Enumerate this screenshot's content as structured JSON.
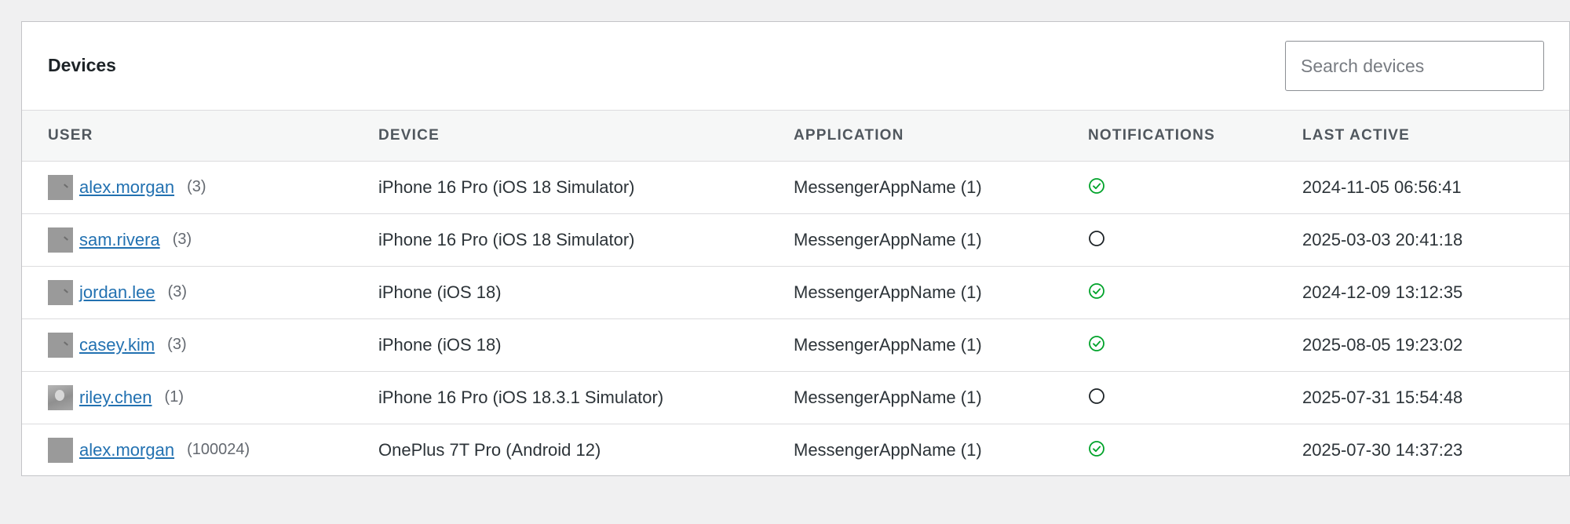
{
  "panel": {
    "title": "Devices",
    "search_placeholder": "Search devices"
  },
  "columns": {
    "user": "USER",
    "device": "DEVICE",
    "application": "APPLICATION",
    "notifications": "NOTIFICATIONS",
    "last_active": "LAST ACTIVE"
  },
  "rows": [
    {
      "user": "alex.morgan",
      "count": "(3)",
      "device": "iPhone 16 Pro (iOS 18 Simulator)",
      "application": "MessengerAppName (1)",
      "notifications": "enabled-check-icon",
      "last_active": "2024-11-05 06:56:41"
    },
    {
      "user": "sam.rivera",
      "count": "(3)",
      "device": "iPhone 16 Pro (iOS 18 Simulator)",
      "application": "MessengerAppName (1)",
      "notifications": "disabled-circle-icon",
      "last_active": "2025-03-03 20:41:18"
    },
    {
      "user": "jordan.lee",
      "count": "(3)",
      "device": "iPhone (iOS 18)",
      "application": "MessengerAppName (1)",
      "notifications": "enabled-check-icon",
      "last_active": "2024-12-09 13:12:35"
    },
    {
      "user": "casey.kim",
      "count": "(3)",
      "device": "iPhone (iOS 18)",
      "application": "MessengerAppName (1)",
      "notifications": "enabled-check-icon",
      "last_active": "2025-08-05 19:23:02"
    },
    {
      "user": "riley.chen",
      "count": "(1)",
      "device": "iPhone 16 Pro (iOS 18.3.1 Simulator)",
      "application": "MessengerAppName (1)",
      "notifications": "disabled-circle-icon",
      "last_active": "2025-07-31 15:54:48"
    },
    {
      "user": "alex.morgan",
      "count": "(100024)",
      "device": "OnePlus 7T Pro (Android 12)",
      "application": "MessengerAppName (1)",
      "notifications": "enabled-check-icon",
      "last_active": "2025-07-30 14:37:23"
    }
  ],
  "colors": {
    "link": "#2271b1",
    "enabled": "#00a32a",
    "disabled": "#1d2327"
  }
}
